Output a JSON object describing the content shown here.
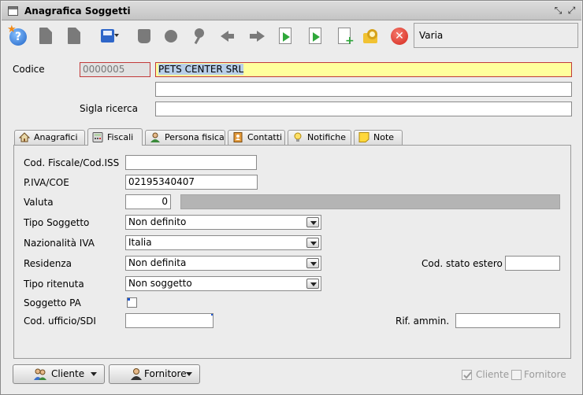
{
  "window": {
    "title": "Anagrafica Soggetti"
  },
  "toolbar": {
    "icons": [
      "help-icon",
      "gray-document-icon",
      "gray-document-copy-icon",
      "save-icon",
      "trash-icon",
      "puzzle-icon",
      "key-icon",
      "arrow-left-icon",
      "arrow-right-icon",
      "import-doc-icon",
      "export-doc-icon",
      "new-doc-icon",
      "search-folder-icon",
      "close-icon"
    ],
    "varia": "Varia"
  },
  "header": {
    "codice_label": "Codice",
    "codice_value": "0000005",
    "ragione_sociale": "PETS CENTER SRL",
    "ragione_sociale_2": "",
    "sigla_label": "Sigla ricerca",
    "sigla_value": ""
  },
  "tabs": [
    {
      "label": "Anagrafici",
      "icon": "house-icon"
    },
    {
      "label": "Fiscali",
      "icon": "calculator-icon",
      "active": true
    },
    {
      "label": "Persona fisica",
      "icon": "person-icon"
    },
    {
      "label": "Contatti",
      "icon": "address-book-icon"
    },
    {
      "label": "Notifiche",
      "icon": "lightbulb-icon"
    },
    {
      "label": "Note",
      "icon": "note-icon"
    }
  ],
  "fiscali": {
    "cod_fiscale_label": "Cod. Fiscale/Cod.ISS",
    "cod_fiscale_value": "",
    "piva_label": "P.IVA/COE",
    "piva_value": "02195340407",
    "valuta_label": "Valuta",
    "valuta_value": "0",
    "tipo_soggetto_label": "Tipo Soggetto",
    "tipo_soggetto_value": "Non definito",
    "nazionalita_label": "Nazionalità IVA",
    "nazionalita_value": "Italia",
    "residenza_label": "Residenza",
    "residenza_value": "Non definita",
    "cod_stato_estero_label": "Cod. stato estero",
    "cod_stato_estero_value": "",
    "tipo_ritenuta_label": "Tipo ritenuta",
    "tipo_ritenuta_value": "Non soggetto",
    "soggetto_pa_label": "Soggetto PA",
    "cod_ufficio_label": "Cod. ufficio/SDI",
    "cod_ufficio_value": "",
    "rif_ammin_label": "Rif. ammin.",
    "rif_ammin_value": ""
  },
  "footer": {
    "cliente_button": "Cliente",
    "fornitore_button": "Fornitore",
    "cliente_check": "Cliente",
    "fornitore_check": "Fornitore"
  }
}
